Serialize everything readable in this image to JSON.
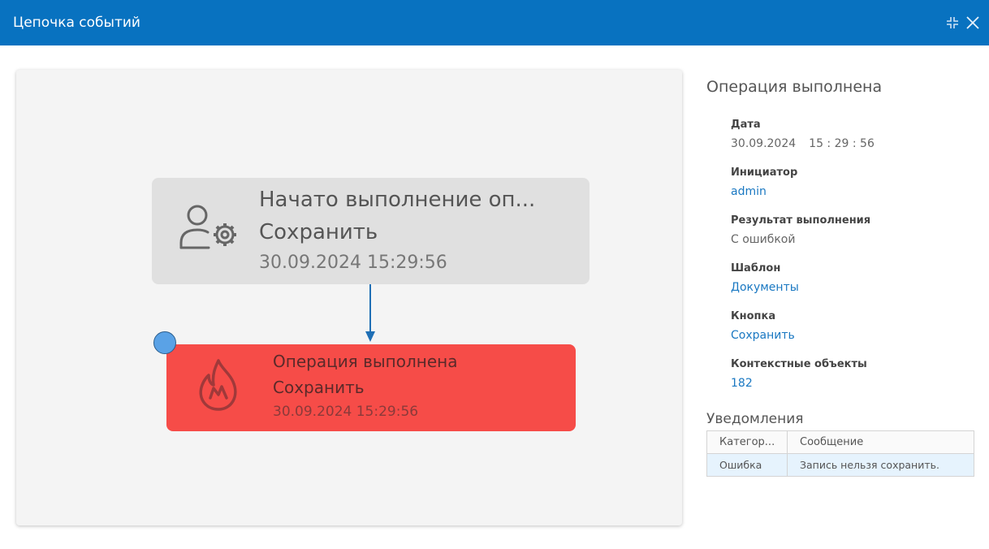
{
  "window": {
    "title": "Цепочка событий"
  },
  "chain": {
    "nodes": [
      {
        "title": "Начато выполнение оп...",
        "action": "Сохранить",
        "datetime": "30.09.2024 15:29:56",
        "icon": "user-gear-icon",
        "color": "#e0e0e0"
      },
      {
        "title": "Операция выполнена",
        "action": "Сохранить",
        "datetime": "30.09.2024 15:29:56",
        "icon": "fire-icon",
        "color": "#f64c48"
      }
    ],
    "connector_color": "#1f6fb5",
    "marker_color": "#5aa2e6"
  },
  "details": {
    "title": "Операция выполнена",
    "date_label": "Дата",
    "date": "30.09.2024",
    "time": "15 : 29 : 56",
    "initiator_label": "Инициатор",
    "initiator": "admin",
    "result_label": "Результат выполнения",
    "result": "С ошибкой",
    "template_label": "Шаблон",
    "template": "Документы",
    "button_label": "Кнопка",
    "button": "Сохранить",
    "context_label": "Контекстные объекты",
    "context": "182"
  },
  "notifications": {
    "title": "Уведомления",
    "columns": [
      "Категор...",
      "Сообщение"
    ],
    "rows": [
      [
        "Ошибка",
        "Запись нельзя сохранить."
      ]
    ]
  },
  "colors": {
    "titlebar": "#0872c0",
    "link": "#1a78c2"
  }
}
